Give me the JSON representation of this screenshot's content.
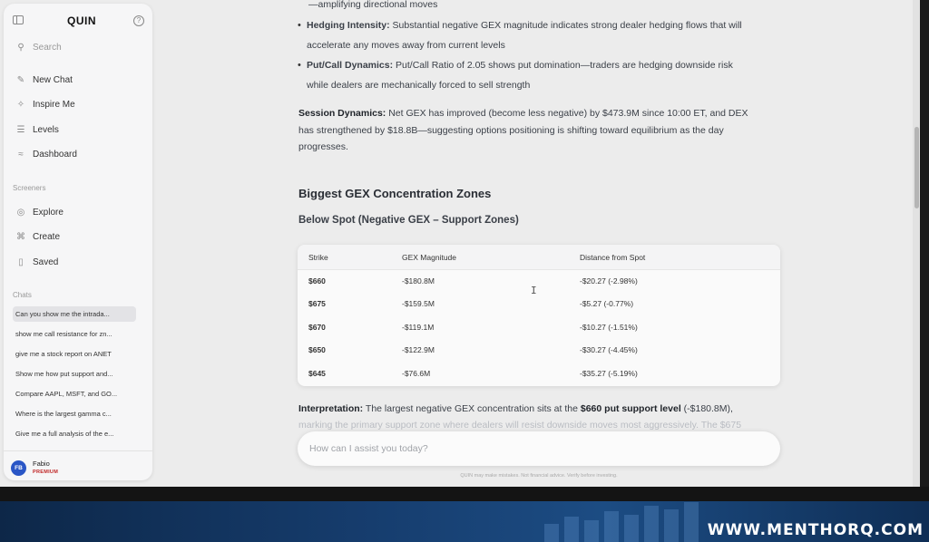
{
  "sidebar": {
    "logo": "QUIN",
    "search_label": "Search",
    "nav": [
      {
        "label": "New Chat",
        "icon": "edit-icon"
      },
      {
        "label": "Inspire Me",
        "icon": "sparkle-icon"
      },
      {
        "label": "Levels",
        "icon": "list-icon"
      },
      {
        "label": "Dashboard",
        "icon": "chart-icon"
      }
    ],
    "screeners_label": "Screeners",
    "screeners": [
      {
        "label": "Explore",
        "icon": "compass-icon"
      },
      {
        "label": "Create",
        "icon": "create-icon"
      },
      {
        "label": "Saved",
        "icon": "bookmark-icon"
      }
    ],
    "chats_label": "Chats",
    "chats": [
      "Can you show me the intrada...",
      "show me call resistance for zn...",
      "give me a stock report on ANET",
      "Show me how put support and...",
      "Compare AAPL, MSFT, and GO...",
      "Where is the largest gamma c...",
      "Give me a full analysis of the e..."
    ],
    "user": {
      "initials": "FB",
      "name": "Fabio",
      "plan": "PREMIUM"
    }
  },
  "content": {
    "top_line": "—amplifying directional moves",
    "bullets": [
      {
        "bold": "Hedging Intensity:",
        "line1": " Substantial negative GEX magnitude indicates strong dealer hedging flows that will",
        "line2": "accelerate any moves away from current levels"
      },
      {
        "bold": "Put/Call Dynamics:",
        "line1": " Put/Call Ratio of 2.05 shows put domination—traders are hedging downside risk",
        "line2": "while dealers are mechanically forced to sell strength"
      }
    ],
    "session": {
      "bold": "Session Dynamics:",
      "line1": " Net GEX has improved (become less negative) by $473.9M since 10:00 ET, and DEX",
      "line2": "has strengthened by $18.8B—suggesting options positioning is shifting toward equilibrium as the day",
      "line3": "progresses."
    },
    "heading": "Biggest GEX Concentration Zones",
    "subheading": "Below Spot (Negative GEX – Support Zones)",
    "table": {
      "headers": [
        "Strike",
        "GEX Magnitude",
        "Distance from Spot"
      ],
      "rows": [
        [
          "$660",
          "-$180.8M",
          "-$20.27 (-2.98%)"
        ],
        [
          "$675",
          "-$159.5M",
          "-$5.27 (-0.77%)"
        ],
        [
          "$670",
          "-$119.1M",
          "-$10.27 (-1.51%)"
        ],
        [
          "$650",
          "-$122.9M",
          "-$30.27 (-4.45%)"
        ],
        [
          "$645",
          "-$76.6M",
          "-$35.27 (-5.19%)"
        ]
      ]
    },
    "interpretation": {
      "bold": "Interpretation:",
      "text1": " The largest negative GEX concentration sits at the ",
      "bold2": "$660 put support level",
      "text2": " (-$180.8M),"
    },
    "faded_line": "marking the primary support zone where dealers will resist downside moves most aggressively. The $675",
    "input_placeholder": "How can I assist you today?",
    "disclaimer": "QUIN may make mistakes. Not financial advice. Verify before investing."
  },
  "banner": {
    "url": "WWW.MENTHORQ.COM"
  }
}
